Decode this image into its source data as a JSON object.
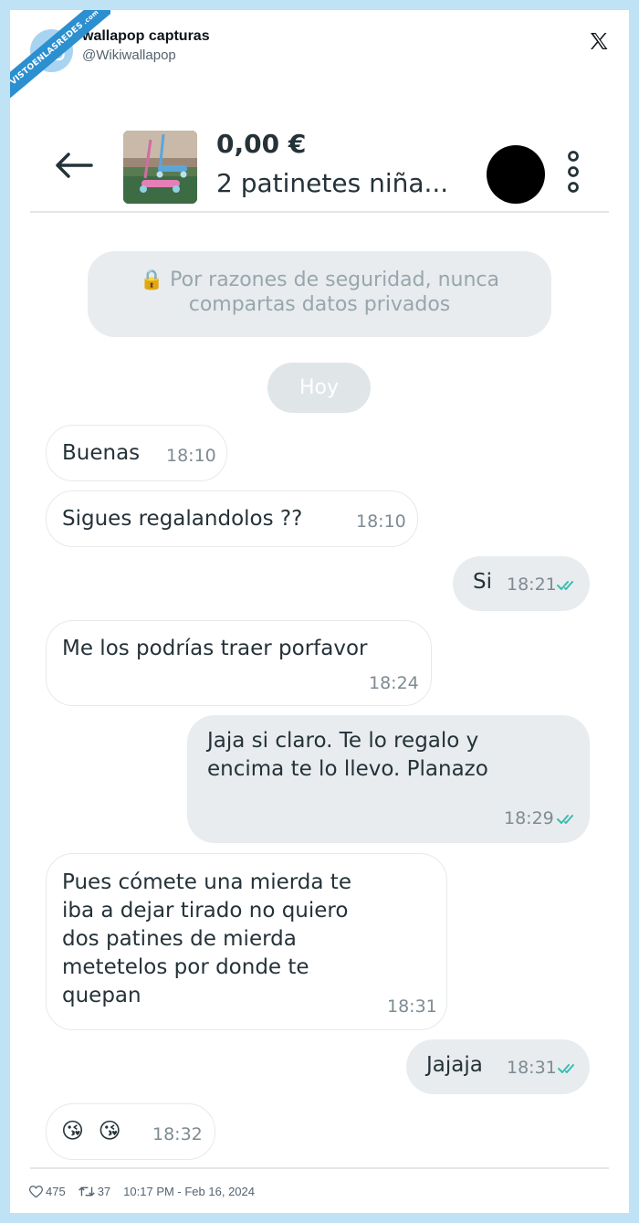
{
  "watermark": {
    "text": "VISTOENLASREDES",
    "sub": ".com"
  },
  "tweet": {
    "author_name": "wallapop capturas",
    "author_handle": "@Wikiwallapop",
    "likes": "475",
    "retweets": "37",
    "timestamp": "10:17 PM - Feb 16, 2024"
  },
  "chat": {
    "price": "0,00 €",
    "product_title": "2 patinetes niña...",
    "safety_notice_line1": "Por razones de seguridad, nunca",
    "safety_notice_line2": "compartas datos privados",
    "day_label": "Hoy",
    "messages": [
      {
        "direction": "in",
        "text": "Buenas",
        "time": "18:10"
      },
      {
        "direction": "in",
        "text": "Sigues regalandolos ??",
        "time": "18:10"
      },
      {
        "direction": "out",
        "text": "Si",
        "time": "18:21",
        "status": "read"
      },
      {
        "direction": "in",
        "text": "Me los podrías traer porfavor",
        "time": "18:24"
      },
      {
        "direction": "out",
        "text": "Jaja si claro. Te lo regalo y\nencima te lo llevo. Planazo",
        "time": "18:29",
        "status": "read"
      },
      {
        "direction": "in",
        "text": "Pues cómete una mierda te\niba a dejar tirado no quiero\ndos patines de mierda\nmetetelos por donde te\nquepan",
        "time": "18:31"
      },
      {
        "direction": "out",
        "text": "Jajaja",
        "time": "18:31",
        "status": "read"
      },
      {
        "direction": "in",
        "text": "😘 😘",
        "time": "18:32"
      }
    ]
  },
  "colors": {
    "tick_read": "#3dbcb1",
    "bubble_out": "#e8ecee",
    "text_primary": "#253238",
    "frame": "#bfe2f4"
  },
  "icons": [
    "back-arrow-icon",
    "x-logo-icon",
    "more-vertical-icon",
    "lock-icon",
    "heart-icon",
    "retweet-icon",
    "double-check-icon",
    "kiss-emoji-icon"
  ]
}
